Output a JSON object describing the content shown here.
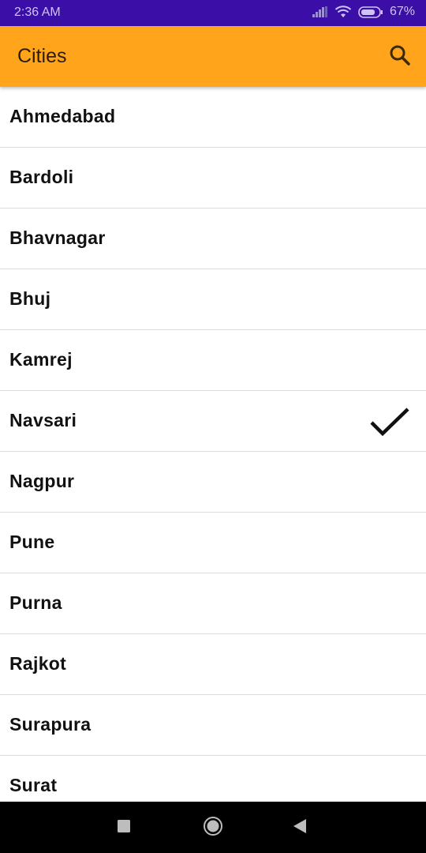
{
  "status_bar": {
    "time": "2:36 AM",
    "battery": "67%",
    "icons": [
      "signal-icon",
      "wifi-icon",
      "battery-icon"
    ]
  },
  "app_bar": {
    "title": "Cities",
    "search_icon": "search-icon"
  },
  "cities": [
    {
      "name": "Ahmedabad",
      "selected": false
    },
    {
      "name": "Bardoli",
      "selected": false
    },
    {
      "name": "Bhavnagar",
      "selected": false
    },
    {
      "name": "Bhuj",
      "selected": false
    },
    {
      "name": "Kamrej",
      "selected": false
    },
    {
      "name": "Navsari",
      "selected": true
    },
    {
      "name": "Nagpur",
      "selected": false
    },
    {
      "name": "Pune",
      "selected": false
    },
    {
      "name": "Purna",
      "selected": false
    },
    {
      "name": "Rajkot",
      "selected": false
    },
    {
      "name": "Surapura",
      "selected": false
    },
    {
      "name": "Surat",
      "selected": false
    }
  ],
  "nav_bar": {
    "buttons": [
      "recents-icon",
      "home-icon",
      "back-icon"
    ]
  },
  "colors": {
    "status_bar": "#3b0fa7",
    "app_bar": "#ffa41b",
    "text": "#111111",
    "divider": "#dcdcdc",
    "nav_bar": "#000000"
  }
}
